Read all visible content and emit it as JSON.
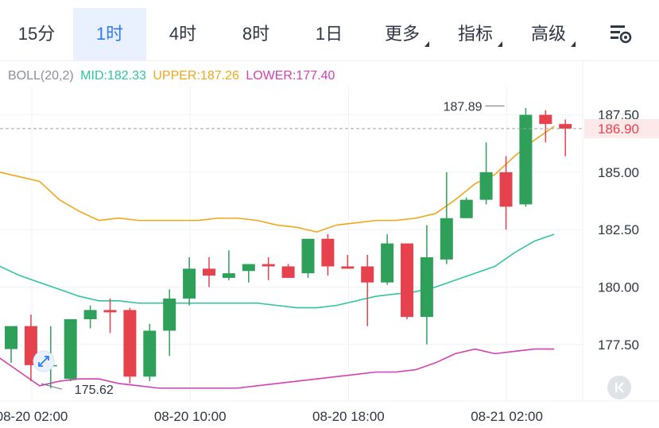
{
  "tabs": [
    {
      "label": "15分",
      "active": false,
      "dropdown": false
    },
    {
      "label": "1时",
      "active": true,
      "dropdown": false
    },
    {
      "label": "4时",
      "active": false,
      "dropdown": false
    },
    {
      "label": "8时",
      "active": false,
      "dropdown": false
    },
    {
      "label": "1日",
      "active": false,
      "dropdown": false
    },
    {
      "label": "更多",
      "active": false,
      "dropdown": true
    },
    {
      "label": "指标",
      "active": false,
      "dropdown": true
    },
    {
      "label": "高级",
      "active": false,
      "dropdown": true
    }
  ],
  "icons": {
    "settings": "chart-settings-icon",
    "collapse": "collapse-arrow-icon",
    "marker": "expand-arrows-icon"
  },
  "legend": {
    "name": "BOLL(20,2)",
    "mid": "MID:182.33",
    "upper": "UPPER:187.26",
    "lower": "LOWER:177.40"
  },
  "colors": {
    "up": "#2ea05a",
    "down": "#e5424d",
    "mid": "#2ec4a0",
    "upper": "#f0a71a",
    "lower": "#d43fb4",
    "accent": "#2f7cf6",
    "label": "#8a9099"
  },
  "chart_data": {
    "type": "candlestick",
    "indicator": "BOLL(20,2)",
    "ylim": [
      175.0,
      188.5
    ],
    "y_ticks": [
      "187.50",
      "185.00",
      "182.50",
      "180.00",
      "177.50"
    ],
    "x_tick_labels": [
      "08-20 02:00",
      "08-20 10:00",
      "08-20 18:00",
      "08-21 02:00"
    ],
    "x_tick_index": [
      0,
      8,
      16,
      24
    ],
    "current_price": "186.90",
    "current_price_value": 186.9,
    "high_label": "187.89",
    "high_label_index": 25,
    "high_label_value": 187.89,
    "low_label": "175.62",
    "low_label_index": 2,
    "low_label_value": 175.62,
    "candles": [
      {
        "o": 177.3,
        "h": 178.1,
        "l": 176.7,
        "c": 178.3
      },
      {
        "o": 178.3,
        "h": 178.8,
        "l": 175.9,
        "c": 176.6
      },
      {
        "o": 176.6,
        "h": 178.3,
        "l": 175.6,
        "c": 176.6
      },
      {
        "o": 176.0,
        "h": 178.6,
        "l": 175.9,
        "c": 178.6
      },
      {
        "o": 178.6,
        "h": 179.2,
        "l": 178.2,
        "c": 179.0
      },
      {
        "o": 179.0,
        "h": 179.5,
        "l": 178.0,
        "c": 178.9
      },
      {
        "o": 179.0,
        "h": 179.1,
        "l": 175.8,
        "c": 176.1
      },
      {
        "o": 176.1,
        "h": 178.4,
        "l": 175.9,
        "c": 178.1
      },
      {
        "o": 178.1,
        "h": 179.9,
        "l": 177.0,
        "c": 179.5
      },
      {
        "o": 179.5,
        "h": 181.3,
        "l": 179.2,
        "c": 180.8
      },
      {
        "o": 180.8,
        "h": 181.3,
        "l": 180.0,
        "c": 180.5
      },
      {
        "o": 180.4,
        "h": 181.6,
        "l": 180.3,
        "c": 180.6
      },
      {
        "o": 180.7,
        "h": 181.0,
        "l": 180.2,
        "c": 181.0
      },
      {
        "o": 181.0,
        "h": 181.3,
        "l": 180.3,
        "c": 180.9
      },
      {
        "o": 180.9,
        "h": 181.0,
        "l": 180.4,
        "c": 180.4
      },
      {
        "o": 180.6,
        "h": 182.1,
        "l": 180.4,
        "c": 182.1
      },
      {
        "o": 182.1,
        "h": 182.3,
        "l": 180.5,
        "c": 180.9
      },
      {
        "o": 180.9,
        "h": 181.4,
        "l": 180.8,
        "c": 180.8
      },
      {
        "o": 180.9,
        "h": 181.4,
        "l": 178.3,
        "c": 180.2
      },
      {
        "o": 180.2,
        "h": 182.3,
        "l": 180.1,
        "c": 181.9
      },
      {
        "o": 181.9,
        "h": 181.9,
        "l": 178.6,
        "c": 178.7
      },
      {
        "o": 178.7,
        "h": 182.7,
        "l": 177.5,
        "c": 181.3
      },
      {
        "o": 181.2,
        "h": 185.0,
        "l": 181.0,
        "c": 183.0
      },
      {
        "o": 183.0,
        "h": 183.9,
        "l": 183.0,
        "c": 183.8
      },
      {
        "o": 183.8,
        "h": 186.3,
        "l": 183.6,
        "c": 185.0
      },
      {
        "o": 185.0,
        "h": 185.7,
        "l": 182.5,
        "c": 183.5
      },
      {
        "o": 183.6,
        "h": 187.8,
        "l": 183.5,
        "c": 187.5
      },
      {
        "o": 187.5,
        "h": 187.7,
        "l": 186.3,
        "c": 187.1
      },
      {
        "o": 187.1,
        "h": 187.3,
        "l": 185.7,
        "c": 186.9
      }
    ],
    "series": [
      {
        "name": "UPPER",
        "values": [
          185.0,
          184.8,
          184.6,
          183.8,
          183.3,
          182.9,
          183.0,
          182.9,
          182.9,
          182.9,
          182.9,
          183.0,
          183.0,
          182.9,
          182.7,
          182.6,
          182.4,
          182.7,
          182.8,
          182.9,
          182.9,
          183.0,
          183.2,
          183.8,
          184.5,
          184.9,
          185.7,
          186.4,
          187.0
        ]
      },
      {
        "name": "MID",
        "values": [
          180.9,
          180.5,
          180.2,
          179.9,
          179.6,
          179.4,
          179.4,
          179.3,
          179.3,
          179.3,
          179.3,
          179.3,
          179.3,
          179.3,
          179.2,
          179.1,
          179.1,
          179.2,
          179.4,
          179.6,
          179.7,
          179.8,
          180.0,
          180.3,
          180.6,
          180.9,
          181.5,
          182.0,
          182.3
        ]
      },
      {
        "name": "LOWER",
        "values": [
          176.9,
          176.3,
          175.7,
          175.9,
          176.0,
          176.0,
          175.8,
          175.7,
          175.6,
          175.6,
          175.6,
          175.6,
          175.6,
          175.7,
          175.8,
          175.9,
          176.0,
          176.1,
          176.2,
          176.3,
          176.3,
          176.4,
          176.7,
          177.1,
          177.3,
          177.1,
          177.2,
          177.3,
          177.3
        ]
      }
    ]
  }
}
